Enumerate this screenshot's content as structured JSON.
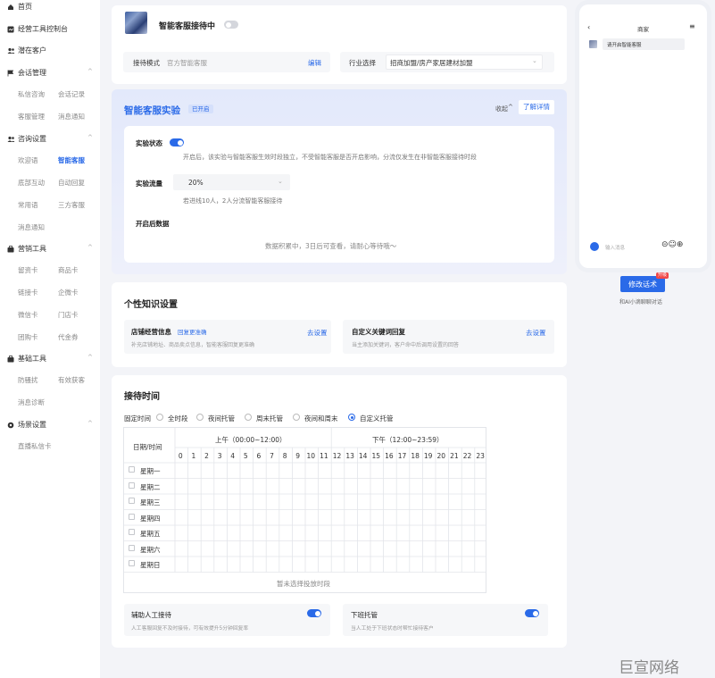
{
  "sidebar": {
    "top_items": [
      {
        "label": "首页",
        "icon": "home-icon"
      },
      {
        "label": "经营工具控制台",
        "icon": "dashboard-icon"
      },
      {
        "label": "潜在客户",
        "icon": "users-icon"
      }
    ],
    "groups": [
      {
        "label": "会话管理",
        "icon": "flag-icon",
        "items": [
          "私信咨询",
          "会话记录",
          "客服管理",
          "消息通知"
        ]
      },
      {
        "label": "咨询设置",
        "icon": "users-icon",
        "items": [
          "欢迎语",
          "智能客服",
          "底部互动",
          "自动回复",
          "常用语",
          "三方客服",
          "消息通知"
        ]
      },
      {
        "label": "营销工具",
        "icon": "tool-icon",
        "items": [
          "留资卡",
          "商品卡",
          "链接卡",
          "企微卡",
          "微信卡",
          "门店卡",
          "团购卡",
          "代金券"
        ]
      },
      {
        "label": "基础工具",
        "icon": "tool-icon",
        "items": [
          "防骚扰",
          "有效获客",
          "消息诊断"
        ]
      },
      {
        "label": "场景设置",
        "icon": "gear-icon",
        "items": [
          "直播私信卡"
        ]
      }
    ],
    "active_item": "智能客服"
  },
  "header_card": {
    "title": "智能客服接待中",
    "mode_label": "接待模式",
    "mode_value": "官方智能客服",
    "edit_label": "编辑",
    "industry_label": "行业选择",
    "industry_value": "招商加盟/房产家居建材加盟"
  },
  "experiment": {
    "title": "智能客服实验",
    "status_badge": "已开启",
    "collapse_label": "收起",
    "learn_more": "了解详情",
    "state_label": "实验状态",
    "state_desc": "开启后，该实验与智能客服生效时段独立，不受智能客服是否开启影响，分流仅发生在非智能客服接待时段",
    "flow_label": "实验流量",
    "flow_value": "20%",
    "flow_desc": "若进线10人，2人分流智能客服接待",
    "data_title": "开启后数据",
    "data_empty": "数据积累中，3日后可查看，请耐心等待哦～"
  },
  "knowledge": {
    "title": "个性知识设置",
    "items": [
      {
        "title": "店铺经营信息",
        "tag": "回复更准确",
        "desc": "补充店铺地址、商品卖点信息，智能客服回复更准确",
        "action": "去设置"
      },
      {
        "title": "自定义关键词回复",
        "tag": "",
        "desc": "当主添加关键词，客户命中后调用设置的回答",
        "action": "去设置"
      }
    ]
  },
  "reception": {
    "title": "接待时间",
    "fixed_label": "固定时间",
    "options": [
      "全时段",
      "夜间托管",
      "周末托管",
      "夜间和周末",
      "自定义托管"
    ],
    "selected_option": "自定义托管",
    "grid_header": "日期/时间",
    "am_label": "上午（00:00~12:00）",
    "pm_label": "下午（12:00~23:59）",
    "hours": [
      "0",
      "1",
      "2",
      "3",
      "4",
      "5",
      "6",
      "7",
      "8",
      "9",
      "10",
      "11",
      "12",
      "13",
      "14",
      "15",
      "16",
      "17",
      "18",
      "19",
      "20",
      "21",
      "22",
      "23"
    ],
    "days": [
      "星期一",
      "星期二",
      "星期三",
      "星期四",
      "星期五",
      "星期六",
      "星期日"
    ],
    "empty_hint": "暂未选择投放时段",
    "assist": {
      "title": "辅助人工接待",
      "desc": "人工客服回复不及时接待，可有效提升5分钟回复率"
    },
    "offwork": {
      "title": "下班托管",
      "desc": "当人工处于下班状态时帮忙接待客户"
    }
  },
  "phone": {
    "title": "商家",
    "bubble": "请开启智能客服",
    "input_placeholder": "输入消息"
  },
  "modify_button": "修改话术",
  "upgrade_badge": "升级",
  "modify_caption": "和AI小滴聊聊对话",
  "watermark": "巨宣网络",
  "colors": {
    "accent": "#2a6ae8",
    "badge": "#f04848"
  }
}
